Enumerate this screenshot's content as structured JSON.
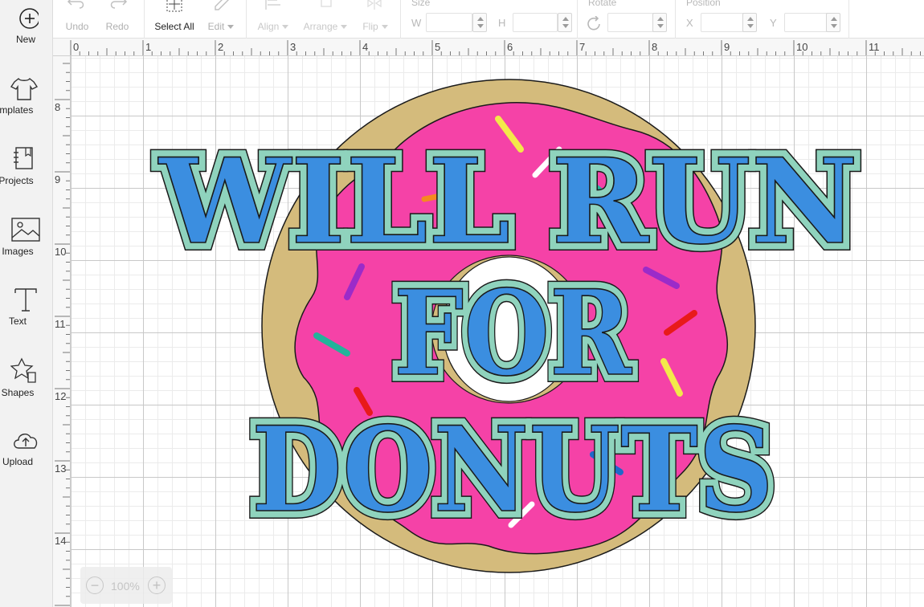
{
  "sidebar": {
    "items": [
      {
        "label": "New",
        "icon": "plus-circle-icon"
      },
      {
        "label": "Templates",
        "icon": "shirt-icon"
      },
      {
        "label": "Projects",
        "icon": "book-icon"
      },
      {
        "label": "Images",
        "icon": "image-icon"
      },
      {
        "label": "Text",
        "icon": "text-icon"
      },
      {
        "label": "Shapes",
        "icon": "shapes-icon"
      },
      {
        "label": "Upload",
        "icon": "cloud-upload-icon"
      }
    ]
  },
  "toolbar": {
    "undo_label": "Undo",
    "redo_label": "Redo",
    "select_all_label": "Select All",
    "edit_label": "Edit",
    "align_label": "Align",
    "arrange_label": "Arrange",
    "flip_label": "Flip",
    "size_label": "Size",
    "w_label": "W",
    "h_label": "H",
    "rotate_label": "Rotate",
    "position_label": "Position",
    "x_label": "X",
    "y_label": "Y"
  },
  "ruler": {
    "top_numbers": [
      "0",
      "1",
      "2",
      "3",
      "4",
      "5",
      "6",
      "7",
      "8",
      "9",
      "10",
      "11"
    ],
    "left_numbers": [
      "8",
      "9",
      "10",
      "11",
      "12",
      "13",
      "14"
    ]
  },
  "design": {
    "line1": "WILL RUN",
    "line2": "FOR",
    "line3": "DONUTS",
    "colors": {
      "dough": "#d4bb7c",
      "icing": "#f542a7",
      "letter_fill": "#3b8ee0",
      "letter_outline": "#8fd3bd",
      "stroke": "#1a1a1a"
    }
  },
  "zoom": {
    "value": "100%",
    "minus": "−",
    "plus": "+"
  }
}
